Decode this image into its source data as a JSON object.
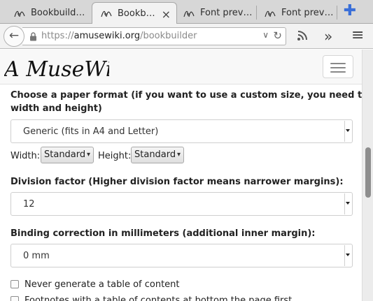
{
  "tabs": [
    {
      "title": "Bookbuild…",
      "active": false
    },
    {
      "title": "Bookb…",
      "active": true,
      "close_glyph": "×"
    },
    {
      "title": "Font prev…",
      "active": false
    },
    {
      "title": "Font prev…",
      "active": false
    }
  ],
  "new_tab_glyph": "✚",
  "navbar": {
    "back_glyph": "←",
    "url_scheme": "https://",
    "url_host": "amusewiki.org",
    "url_path": "/bookbuilder",
    "dropdown_glyph": "∨",
    "reload_glyph": "↻",
    "rss_glyph": "◉",
    "overflow_glyph": "»",
    "menu_glyph": "≡"
  },
  "site": {
    "logo_text": "A MuseWiki"
  },
  "form": {
    "paper_label_line1": "Choose a paper format (if you want to use a custom size, you need to set both",
    "paper_label_line2": "width and height)",
    "paper_value": "Generic (fits in A4 and Letter)",
    "width_label": "Width:",
    "width_value": "Standard",
    "height_label": "Height:",
    "height_value": "Standard",
    "division_label": "Division factor (Higher division factor means narrower margins):",
    "division_value": "12",
    "binding_label": "Binding correction in millimeters (additional inner margin):",
    "binding_value": "0 mm",
    "toc_label": "Never generate a table of content",
    "cut_label": "Footnotes with a table of contents at bottom the page first"
  },
  "colors": {
    "tab_strip": "#d7d7d7",
    "toolbar": "#f2f2f2",
    "new_tab_accent": "#3a6fd8"
  }
}
